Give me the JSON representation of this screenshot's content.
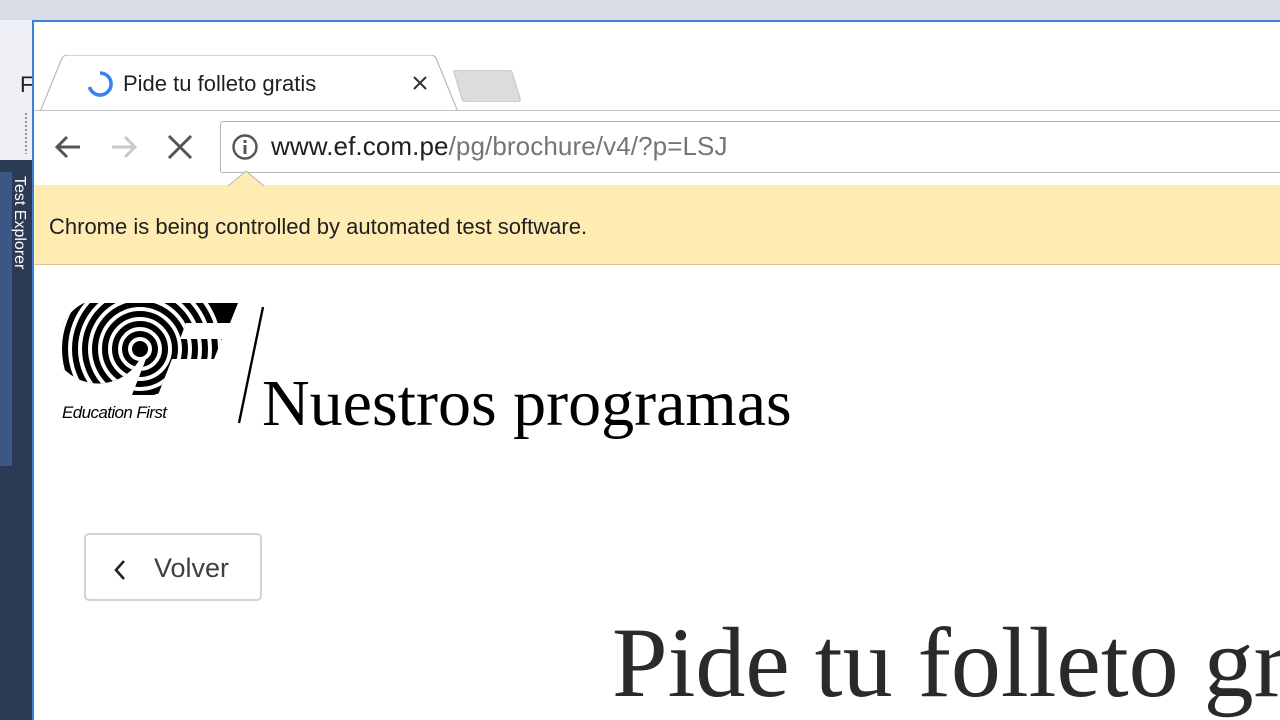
{
  "background": {
    "ide_letter": "F",
    "side_panel_label": "Test Explorer"
  },
  "browser": {
    "tab": {
      "title": "Pide tu folleto gratis",
      "close_icon": "close-icon",
      "loading_icon": "spinner-icon"
    },
    "toolbar": {
      "back_icon": "arrow-left-icon",
      "forward_icon": "arrow-right-icon",
      "stop_icon": "close-icon",
      "security_icon": "info-icon"
    },
    "omnibox": {
      "url_host": "www.ef.com.pe",
      "url_path": "/pg/brochure/v4/?p=LSJ"
    },
    "infobar": {
      "message": "Chrome is being controlled by automated test software."
    }
  },
  "page": {
    "logo_caption": "Education First",
    "section_title": "Nuestros programas",
    "back_button_label": "Volver",
    "hero_title": "Pide tu folleto gratis"
  },
  "colors": {
    "infobar_bg": "#feecb3",
    "window_border": "#3d7fd4",
    "spinner": "#3b82f0",
    "ide_dark": "#2b3a55"
  }
}
